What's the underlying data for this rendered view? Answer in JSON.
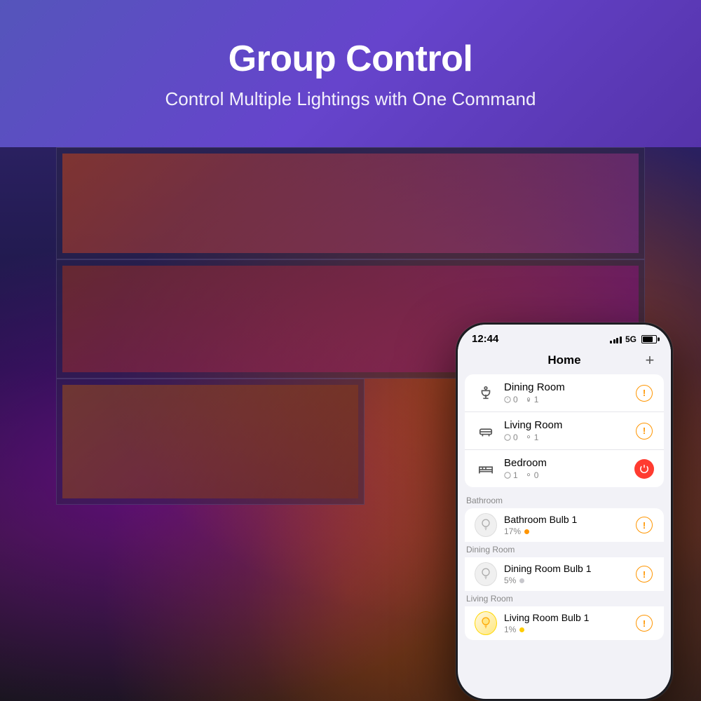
{
  "header": {
    "main_title": "Group Control",
    "sub_title": "Control Multiple Lightings with One Command"
  },
  "phone": {
    "status_bar": {
      "time": "12:44",
      "network": "5G"
    },
    "app_title": "Home",
    "add_button_label": "+",
    "rooms": [
      {
        "name": "Dining Room",
        "icon": "🍽",
        "plugs": 0,
        "bulbs": 1,
        "action": "alert"
      },
      {
        "name": "Living Room",
        "icon": "🛋",
        "plugs": 0,
        "bulbs": 1,
        "action": "alert"
      },
      {
        "name": "Bedroom",
        "icon": "🛏",
        "plugs": 1,
        "bulbs": 0,
        "action": "power"
      }
    ],
    "sections": [
      {
        "label": "Bathroom",
        "devices": [
          {
            "name": "Bathroom Bulb 1",
            "status": "17%",
            "dot_color": "orange",
            "action": "alert",
            "icon_type": "bulb-inactive"
          }
        ]
      },
      {
        "label": "Dining Room",
        "devices": [
          {
            "name": "Dining Room Bulb 1",
            "status": "5%",
            "dot_color": "gray",
            "action": "alert",
            "icon_type": "bulb-inactive"
          }
        ]
      },
      {
        "label": "Living Room",
        "devices": [
          {
            "name": "Living Room Bulb 1",
            "status": "1%",
            "dot_color": "yellow",
            "action": "alert",
            "icon_type": "bulb-active"
          }
        ]
      }
    ]
  }
}
